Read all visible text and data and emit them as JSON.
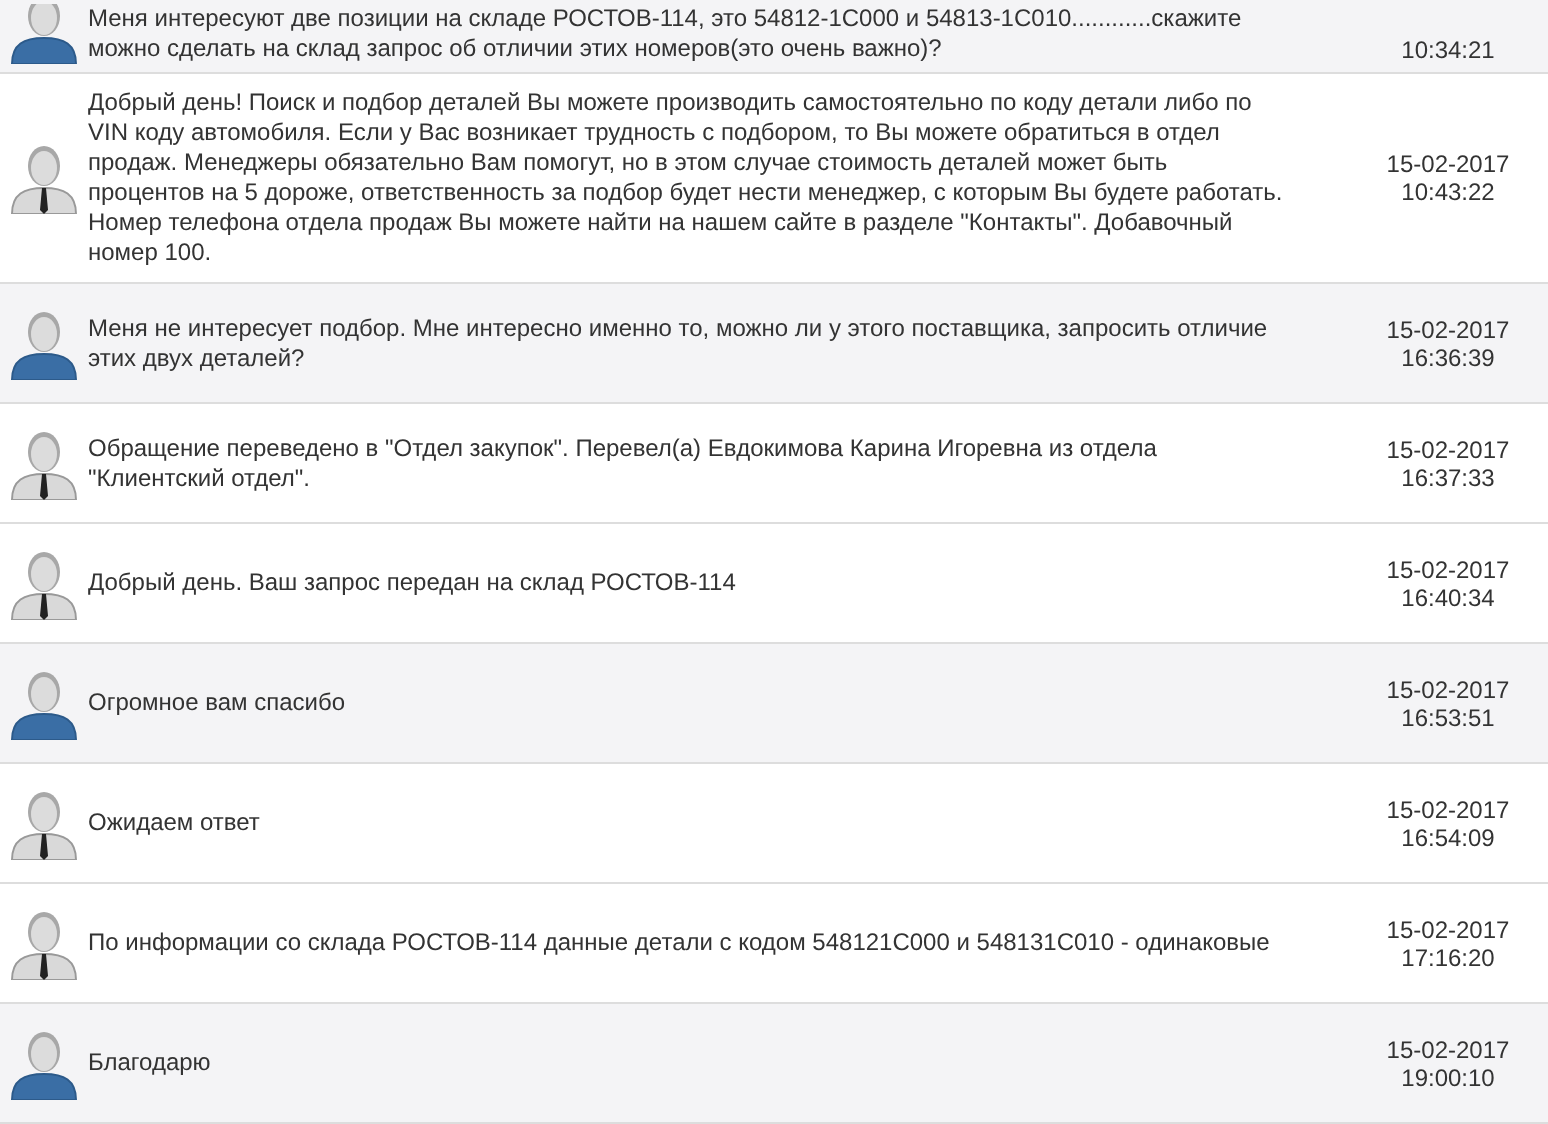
{
  "messages": [
    {
      "kind": "client",
      "text": "Меня интересуют две позиции на складе РОСТОВ-114, это 54812-1C000 и 54813-1C010............скажите можно сделать на склад запрос об отличии этих номеров(это очень важно)?",
      "time": "10:34:21"
    },
    {
      "kind": "manager",
      "text": "Добрый день! Поиск и подбор деталей Вы можете производить самостоятельно по коду детали либо по VIN коду автомобиля. Если у Вас возникает трудность с подбором, то Вы можете обратиться в отдел продаж. Менеджеры обязательно Вам помогут, но в этом случае стоимость деталей может быть процентов на 5 дороже, ответственность за подбор будет нести менеджер, с которым Вы будете работать.\nНомер телефона отдела продаж Вы можете найти на нашем сайте в разделе \"Контакты\". Добавочный номер 100.",
      "date": "15-02-2017",
      "time": "10:43:22"
    },
    {
      "kind": "client",
      "text": "Меня не интересует подбор. Мне интересно именно то, можно ли у этого поставщика, запросить отличие этих двух деталей?",
      "date": "15-02-2017",
      "time": "16:36:39"
    },
    {
      "kind": "manager",
      "text": "Обращение переведено в \"Отдел закупок\". Перевел(а) Евдокимова Карина Игоревна из отдела \"Клиентский отдел\".",
      "date": "15-02-2017",
      "time": "16:37:33"
    },
    {
      "kind": "manager",
      "text": "Добрый день. Ваш запрос передан на склад РОСТОВ-114",
      "date": "15-02-2017",
      "time": "16:40:34"
    },
    {
      "kind": "client",
      "text": "Огромное вам спасибо",
      "date": "15-02-2017",
      "time": "16:53:51"
    },
    {
      "kind": "manager",
      "text": "Ожидаем ответ",
      "date": "15-02-2017",
      "time": "16:54:09"
    },
    {
      "kind": "manager",
      "text": "По информации со склада РОСТОВ-114 данные детали с кодом 548121C000 и 548131C010 - одинаковые",
      "date": "15-02-2017",
      "time": "17:16:20"
    },
    {
      "kind": "client",
      "text": "Благодарю",
      "date": "15-02-2017",
      "time": "19:00:10"
    }
  ]
}
